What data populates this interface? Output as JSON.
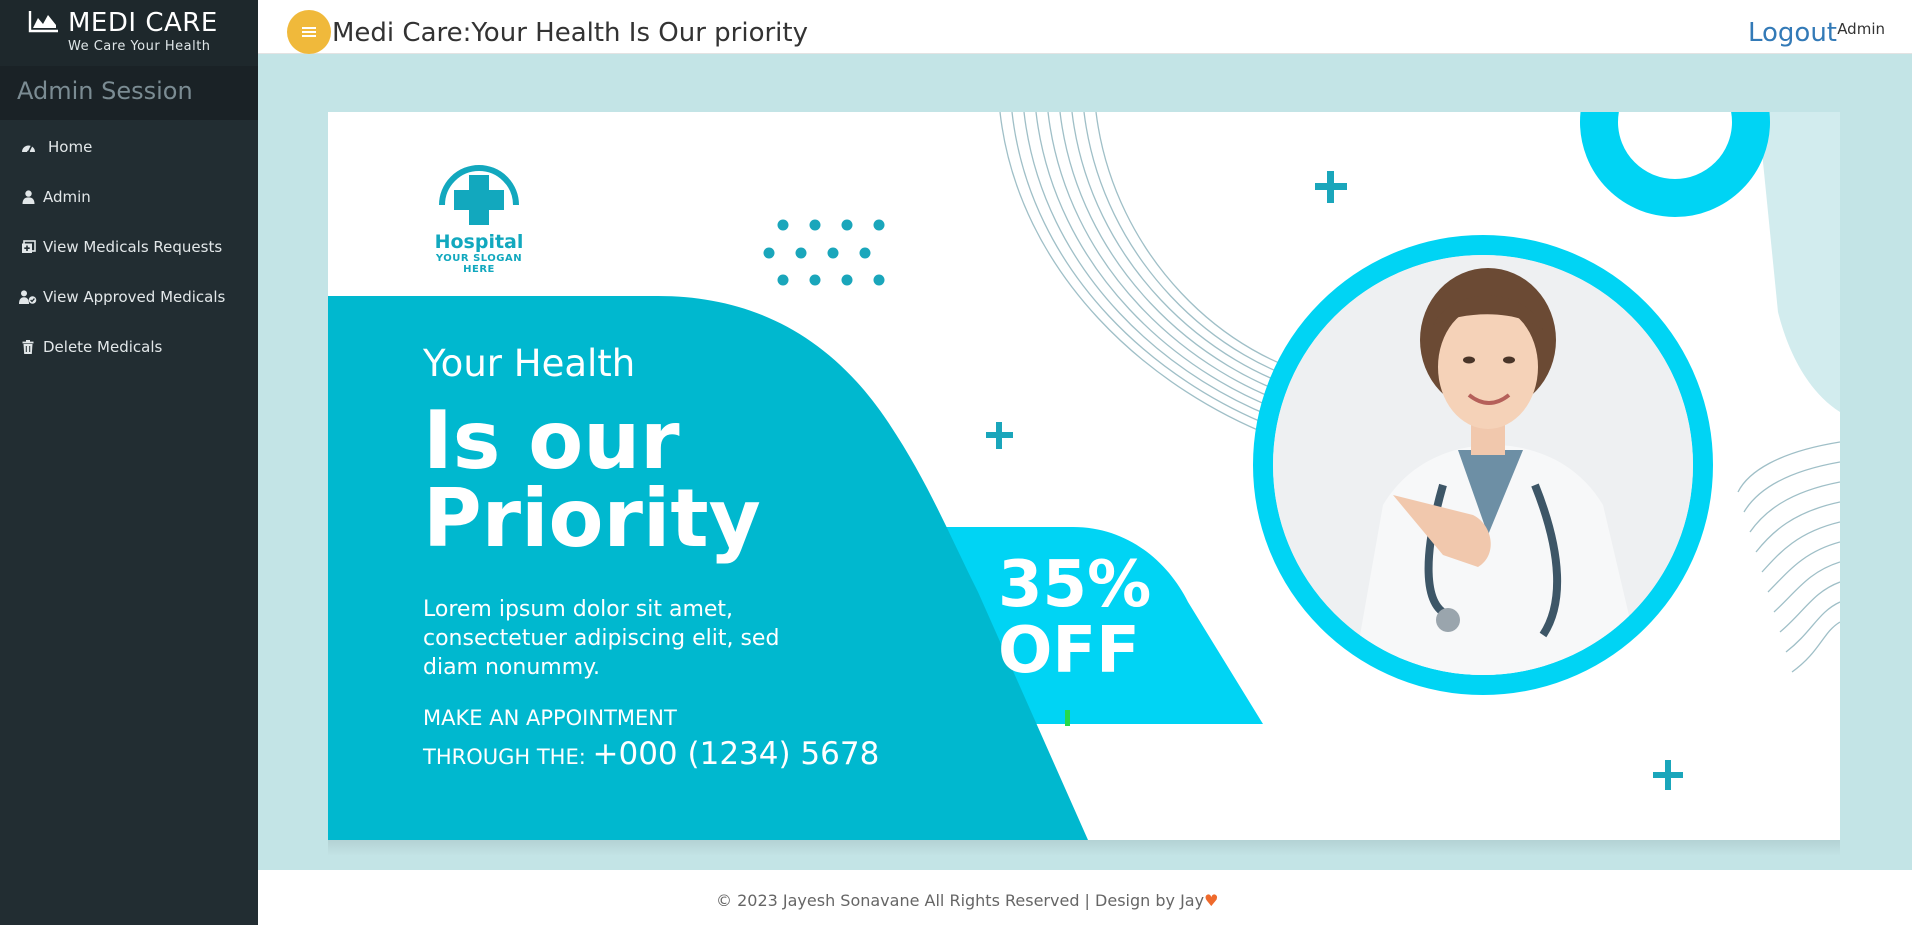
{
  "app": {
    "brand_title": "MEDI CARE",
    "brand_tagline": "We Care Your Health",
    "session_label": "Admin Session"
  },
  "sidebar": {
    "items": [
      {
        "label": "Home",
        "icon": "dashboard-icon"
      },
      {
        "label": "Admin",
        "icon": "user-icon"
      },
      {
        "label": "View Medicals Requests",
        "icon": "medical-kit-icon"
      },
      {
        "label": "View Approved Medicals",
        "icon": "user-check-icon"
      },
      {
        "label": "Delete Medicals",
        "icon": "trash-icon"
      }
    ]
  },
  "header": {
    "page_title": "Medi Care:Your Health Is Our priority",
    "logout_label": "Logout",
    "role_label": "Admin"
  },
  "banner": {
    "hospital_name": "Hospital",
    "hospital_slogan": "YOUR SLOGAN HERE",
    "headline_small": "Your Health",
    "headline_line1": "Is our",
    "headline_line2": "Priority",
    "body_line1": "Lorem ipsum dolor sit amet,",
    "body_line2": "consectetuer adipiscing elit, sed",
    "body_line3": "diam nonummy.",
    "appointment_line1": "MAKE AN APPOINTMENT",
    "appointment_prefix": "THROUGH THE: ",
    "appointment_phone": "+000 (1234) 5678",
    "discount_percent": "35%",
    "discount_word": "OFF"
  },
  "footer": {
    "copyright": "© 2023 Jayesh Sonavane All Rights Reserved | Design by Jay",
    "heart": "♥"
  },
  "colors": {
    "sidebar": "#222d32",
    "toggle": "#f0b93b",
    "link": "#337ab7",
    "banner_teal": "#00b8cf",
    "banner_cyan": "#00d4f4"
  }
}
